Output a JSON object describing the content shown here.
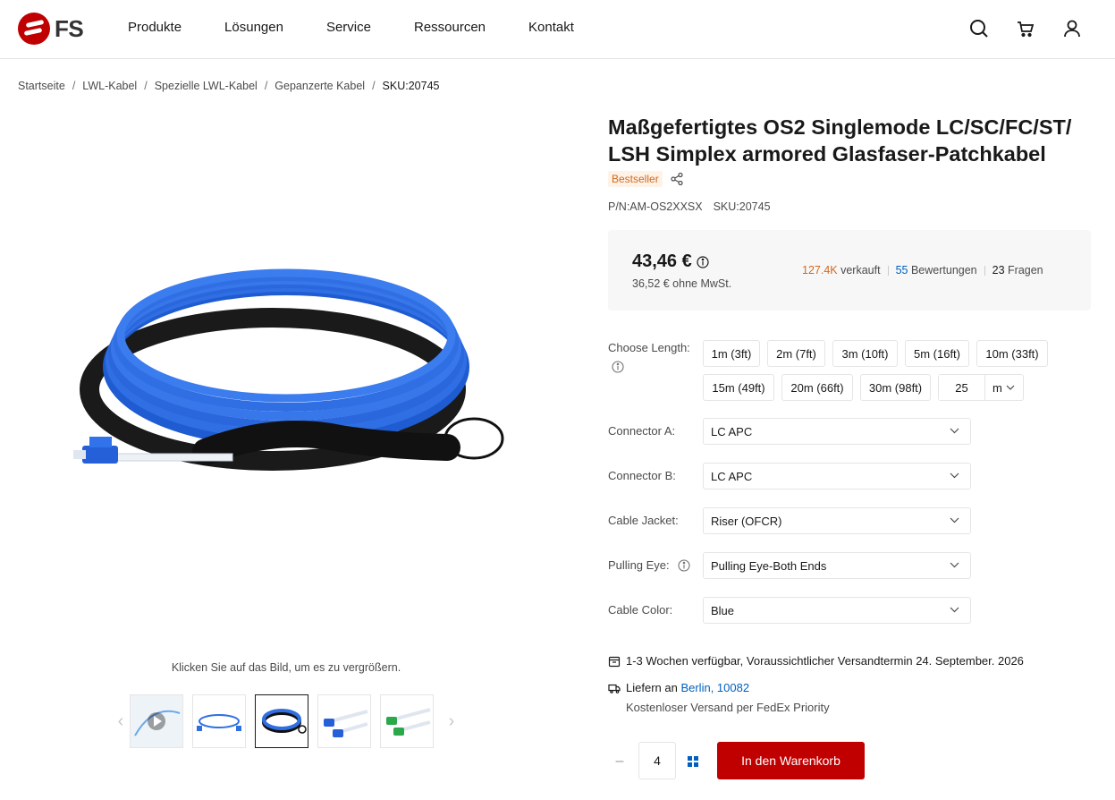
{
  "brand": {
    "logo_text": "FS",
    "accent": "#c00000"
  },
  "nav": {
    "items": [
      "Produkte",
      "Lösungen",
      "Service",
      "Ressourcen",
      "Kontakt"
    ]
  },
  "breadcrumb": [
    "Startseite",
    "LWL-Kabel",
    "Spezielle LWL-Kabel",
    "Gepanzerte Kabel",
    "SKU:20745"
  ],
  "gallery": {
    "zoom_hint": "Klicken Sie auf das Bild, um es zu vergrößern.",
    "thumbnails": [
      "video",
      "patch-cable-loop",
      "armored-coil",
      "lc-connectors-blue",
      "lc-connectors-green"
    ],
    "active_index": 2
  },
  "product": {
    "title": "Maßgefertigtes OS2 Singlemode LC/SC/FC/ST/ LSH Simplex armored Glasfaser-Patchkabel",
    "badge": "Bestseller",
    "pn": "P/N:AM-OS2XXSX",
    "sku": "SKU:20745",
    "price": "43,46 €",
    "price_net": "36,52 € ohne MwSt.",
    "sold_count": "127.4K",
    "sold_label": "verkauft",
    "reviews_count": "55",
    "reviews_label": "Bewertungen",
    "questions_count": "23",
    "questions_label": "Fragen"
  },
  "options": {
    "length_label": "Choose Length:",
    "lengths": [
      "1m (3ft)",
      "2m (7ft)",
      "3m (10ft)",
      "5m (16ft)",
      "10m (33ft)",
      "15m (49ft)",
      "20m (66ft)",
      "30m (98ft)"
    ],
    "custom_length": "25",
    "custom_unit": "m",
    "connector_a_label": "Connector A:",
    "connector_a": "LC APC",
    "connector_b_label": "Connector B:",
    "connector_b": "LC APC",
    "jacket_label": "Cable Jacket:",
    "jacket": "Riser (OFCR)",
    "pulling_eye_label": "Pulling Eye:",
    "pulling_eye": "Pulling Eye-Both Ends",
    "color_label": "Cable Color:",
    "color": "Blue"
  },
  "delivery": {
    "availability": "1-3 Wochen verfügbar, Voraussichtlicher Versandtermin 24. September. 2026",
    "deliver_to_label": "Liefern an",
    "deliver_to": "Berlin, 10082",
    "shipping": "Kostenloser Versand per FedEx Priority"
  },
  "cart": {
    "quantity": "4",
    "button": "In den Warenkorb"
  }
}
